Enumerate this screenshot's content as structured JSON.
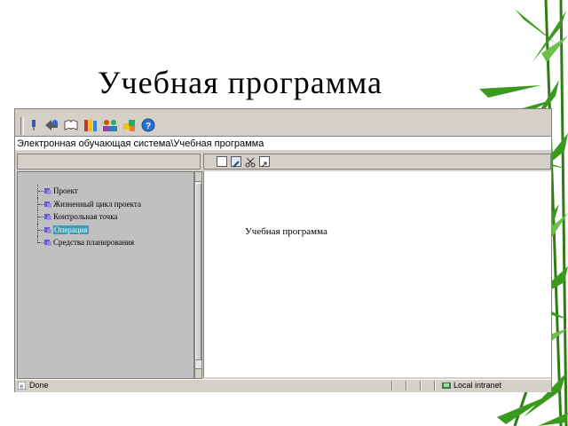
{
  "slide": {
    "title": "Учебная программа"
  },
  "browser": {
    "address_path": "Электронная обучающая система\\Учебная программа",
    "toolbar_icons": [
      "pin-icon",
      "back-icon",
      "book-icon",
      "library-icon",
      "users-icon",
      "puzzle-icon",
      "help-icon"
    ],
    "content_toolbar_icons": [
      "new-document-icon",
      "edit-icon",
      "cut-icon",
      "export-icon"
    ],
    "tree": [
      {
        "label": "Проект",
        "selected": false
      },
      {
        "label": "Жизненный цикл проекта",
        "selected": false
      },
      {
        "label": "Контрольная точка",
        "selected": false
      },
      {
        "label": "Операция",
        "selected": true
      },
      {
        "label": "Средства планирования",
        "selected": false
      }
    ],
    "content_text": "Учебная программа",
    "status": {
      "done": "Done",
      "zone": "Local intranet"
    }
  },
  "colors": {
    "selection": "#3d9bb3",
    "chrome": "#d4d0c8",
    "bamboo": "#3a9a1e"
  }
}
